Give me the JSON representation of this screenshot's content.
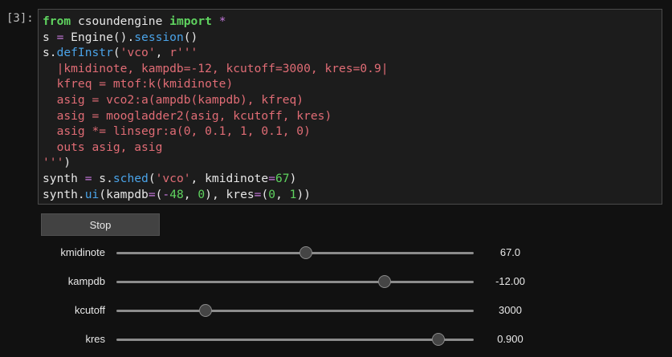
{
  "cell": {
    "prompt": "[3]:",
    "lines": [
      [
        {
          "t": "from",
          "c": "kw"
        },
        {
          "t": " csoundengine "
        },
        {
          "t": "import",
          "c": "kw"
        },
        {
          "t": " "
        },
        {
          "t": "*",
          "c": "op"
        }
      ],
      [
        {
          "t": "s "
        },
        {
          "t": "=",
          "c": "op"
        },
        {
          "t": " Engine()."
        },
        {
          "t": "session",
          "c": "fn"
        },
        {
          "t": "()"
        }
      ],
      [
        {
          "t": "s."
        },
        {
          "t": "defInstr",
          "c": "fn"
        },
        {
          "t": "("
        },
        {
          "t": "'vco'",
          "c": "str"
        },
        {
          "t": ", "
        },
        {
          "t": "r'''",
          "c": "str"
        }
      ],
      [
        {
          "t": "  |kmidinote, kampdb=-12, kcutoff=3000, kres=0.9|",
          "c": "str"
        }
      ],
      [
        {
          "t": "  kfreq = mtof:k(kmidinote)",
          "c": "str"
        }
      ],
      [
        {
          "t": "  asig = vco2:a(ampdb(kampdb), kfreq)",
          "c": "str"
        }
      ],
      [
        {
          "t": "  asig = moogladder2(asig, kcutoff, kres)",
          "c": "str"
        }
      ],
      [
        {
          "t": "  asig *= linsegr:a(0, 0.1, 1, 0.1, 0)",
          "c": "str"
        }
      ],
      [
        {
          "t": "  outs asig, asig",
          "c": "str"
        }
      ],
      [
        {
          "t": "'''",
          "c": "str"
        },
        {
          "t": ")"
        }
      ],
      [
        {
          "t": "synth "
        },
        {
          "t": "=",
          "c": "op"
        },
        {
          "t": " s."
        },
        {
          "t": "sched",
          "c": "fn"
        },
        {
          "t": "("
        },
        {
          "t": "'vco'",
          "c": "str"
        },
        {
          "t": ", kmidinote"
        },
        {
          "t": "=",
          "c": "op"
        },
        {
          "t": "67",
          "c": "num"
        },
        {
          "t": ")"
        }
      ],
      [
        {
          "t": "synth."
        },
        {
          "t": "ui",
          "c": "fn"
        },
        {
          "t": "(kampdb"
        },
        {
          "t": "=",
          "c": "op"
        },
        {
          "t": "("
        },
        {
          "t": "-",
          "c": "op"
        },
        {
          "t": "48",
          "c": "num"
        },
        {
          "t": ", "
        },
        {
          "t": "0",
          "c": "num"
        },
        {
          "t": "), kres"
        },
        {
          "t": "=",
          "c": "op"
        },
        {
          "t": "("
        },
        {
          "t": "0",
          "c": "num"
        },
        {
          "t": ", "
        },
        {
          "t": "1",
          "c": "num"
        },
        {
          "t": "))"
        }
      ]
    ]
  },
  "ui": {
    "stop_label": "Stop",
    "sliders": [
      {
        "name": "kmidinote",
        "value": "67.0",
        "fraction": 0.53
      },
      {
        "name": "kampdb",
        "value": "-12.00",
        "fraction": 0.75
      },
      {
        "name": "kcutoff",
        "value": "3000",
        "fraction": 0.25
      },
      {
        "name": "kres",
        "value": "0.900",
        "fraction": 0.9
      }
    ]
  },
  "colors": {
    "keyword": "#5fd35f",
    "operator": "#c678dd",
    "function": "#4aa3e8",
    "string": "#e06c75",
    "number": "#5fd35f"
  }
}
